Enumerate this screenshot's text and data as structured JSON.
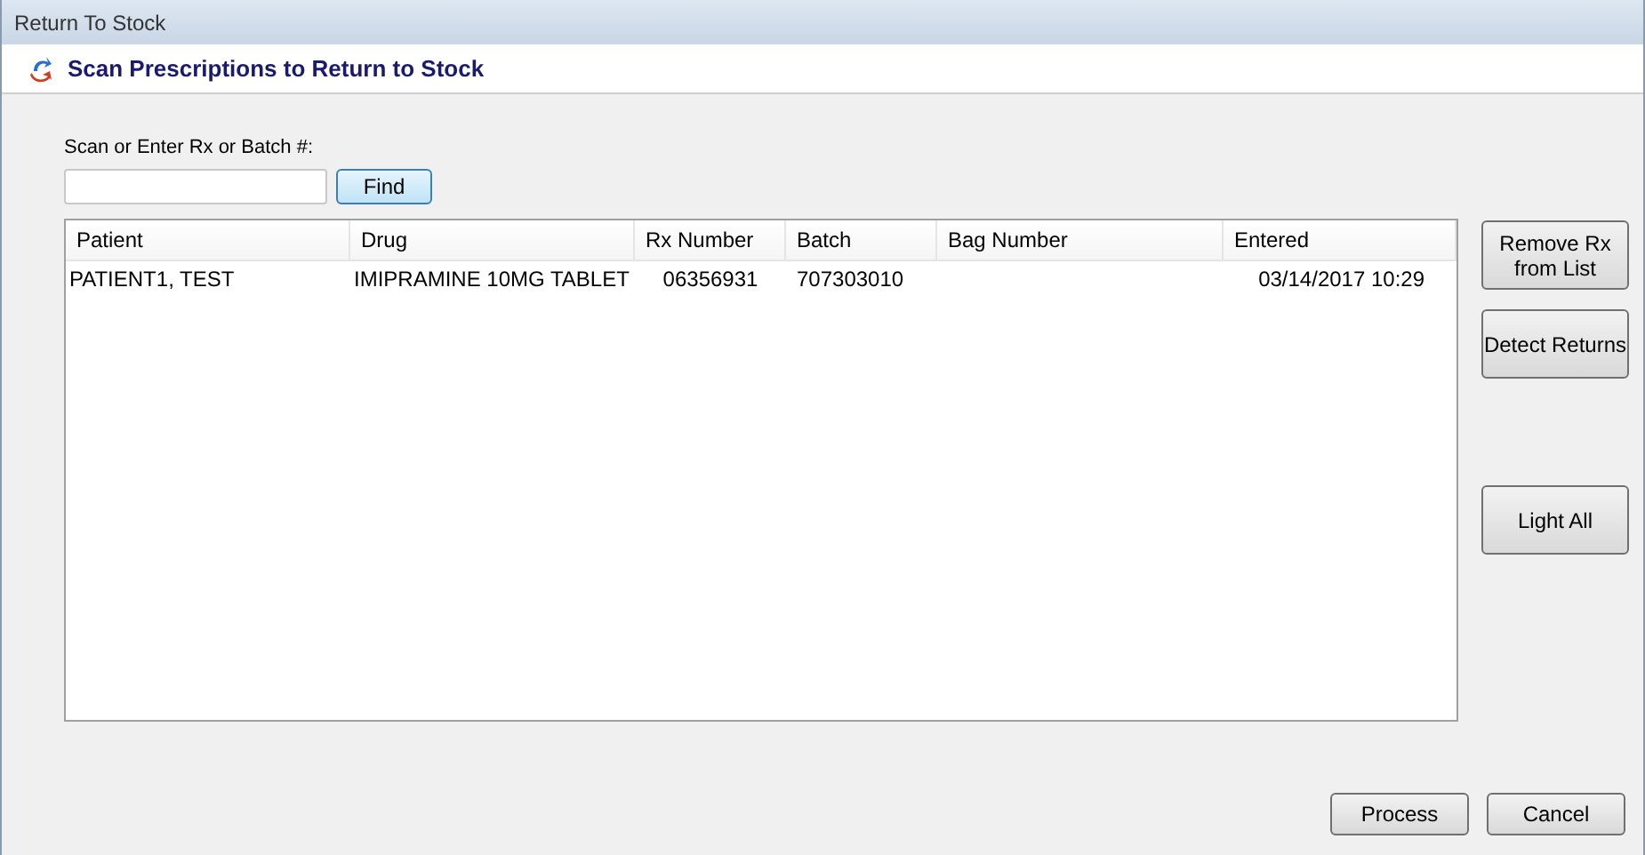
{
  "window": {
    "title": "Return To Stock"
  },
  "header": {
    "title": "Scan Prescriptions to Return to Stock"
  },
  "scan": {
    "label": "Scan or Enter Rx or Batch #:",
    "find_button": "Find"
  },
  "table": {
    "columns": [
      "Patient",
      "Drug",
      "Rx Number",
      "Batch",
      "Bag Number",
      "Entered"
    ],
    "rows": [
      [
        "PATIENT1, TEST",
        "IMIPRAMINE 10MG TABLET",
        "06356931",
        "707303010",
        "",
        "03/14/2017 10:29"
      ]
    ]
  },
  "side_buttons": [
    {
      "label": "Remove Rx from List"
    },
    {
      "label": "Detect Returns"
    },
    {
      "label": "Light All"
    }
  ],
  "footer_buttons": [
    "Process",
    "Cancel"
  ]
}
